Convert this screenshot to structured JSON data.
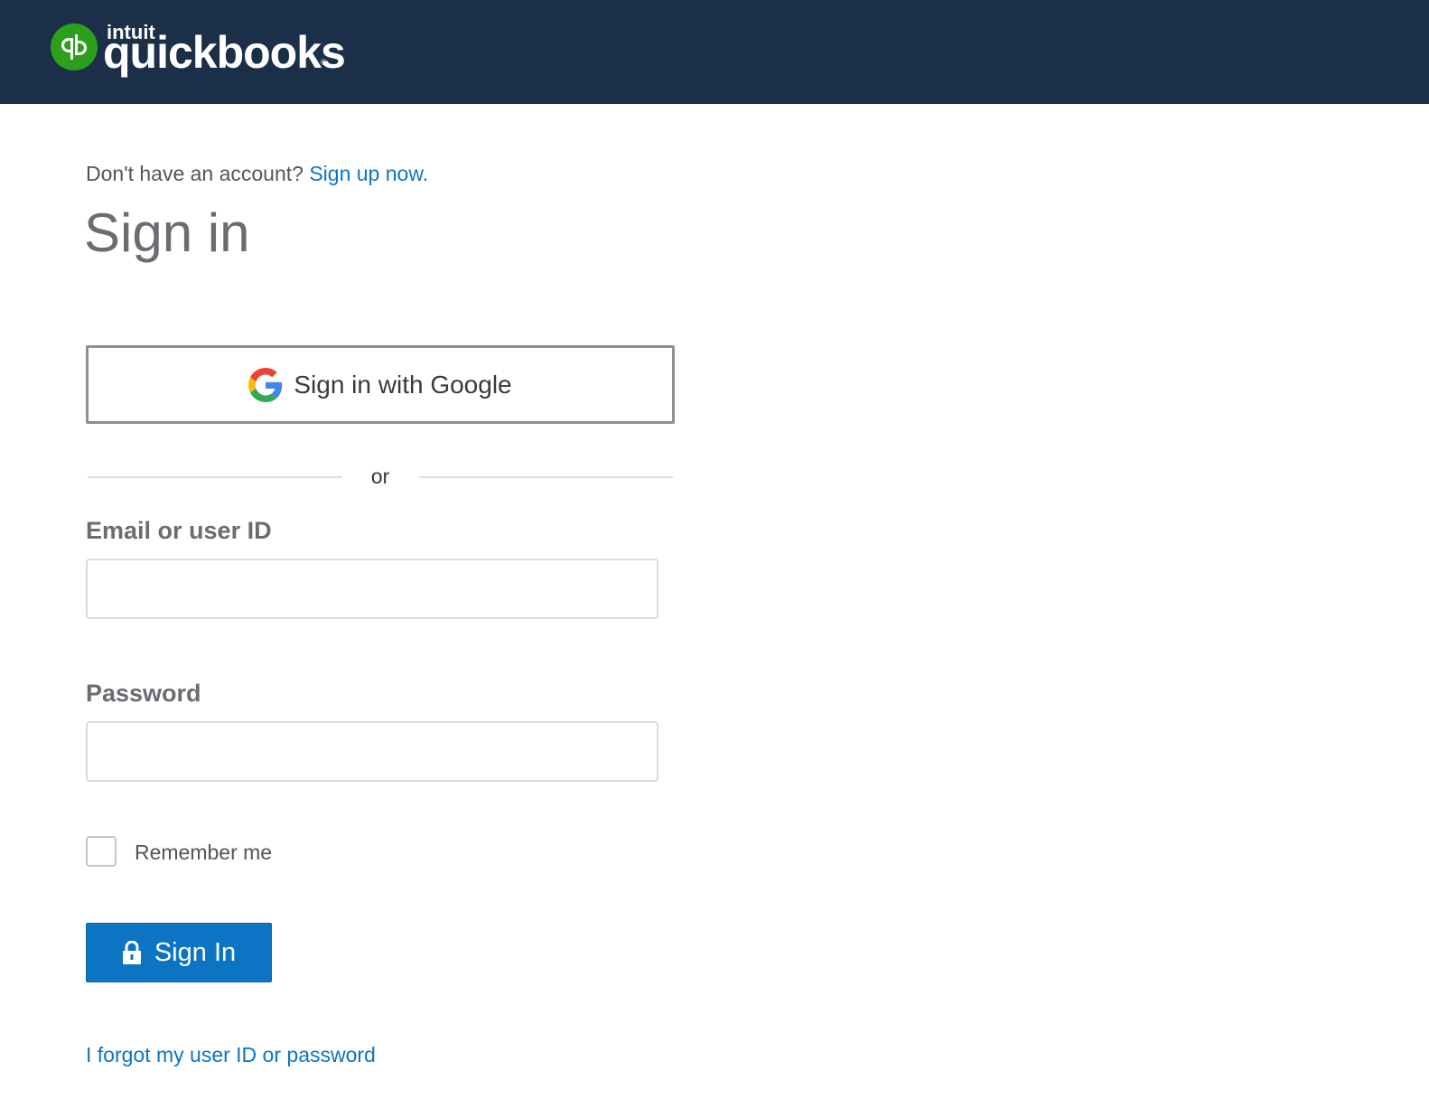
{
  "header": {
    "logo_small": "intuit",
    "logo_main": "quickbooks",
    "logo_reg": "®",
    "logo_icon": "quickbooks-qb-icon",
    "background_color": "#1c2f48",
    "brand_green": "#2ca01c"
  },
  "signup": {
    "prompt": "Don't have an account?",
    "link_label": "Sign up now."
  },
  "page_title": "Sign in",
  "google_button": {
    "label": "Sign in with Google",
    "icon": "google-icon"
  },
  "divider_text": "or",
  "email_field": {
    "label": "Email or user ID",
    "value": "",
    "placeholder": ""
  },
  "password_field": {
    "label": "Password",
    "value": "",
    "placeholder": ""
  },
  "remember_me": {
    "label": "Remember me",
    "checked": false
  },
  "signin_button": {
    "label": "Sign In",
    "icon": "lock-icon",
    "color": "#0d74c4"
  },
  "forgot_link": "I forgot my user ID or password",
  "link_color": "#0d74c4"
}
